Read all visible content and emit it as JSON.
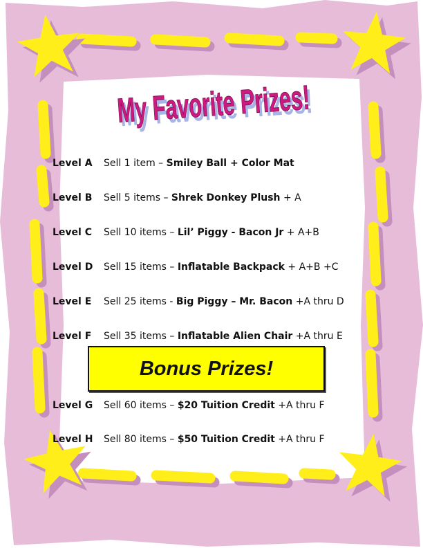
{
  "title": "My Favorite Prizes!",
  "colors": {
    "frame": "#e6bcd9",
    "frame_shadow": "#c48fbd",
    "star": "#ffee1a",
    "title": "#cc1a80",
    "bonus_bg": "#ffff00"
  },
  "levels": [
    {
      "level": "Level A",
      "pre": "Sell 1 item – ",
      "prize": "Smiley Ball + Color Mat",
      "post": ""
    },
    {
      "level": "Level B",
      "pre": "Sell 5 items – ",
      "prize": "Shrek Donkey Plush",
      "post": " + A"
    },
    {
      "level": "Level C",
      "pre": "Sell 10 items – ",
      "prize": "Lil’ Piggy - Bacon Jr",
      "post": " + A+B"
    },
    {
      "level": "Level D",
      "pre": "Sell 15 items – ",
      "prize": "Inflatable Backpack",
      "post": " + A+B +C"
    },
    {
      "level": "Level E",
      "pre": "Sell 25 items - ",
      "prize": "Big Piggy – Mr. Bacon",
      "post": " +A thru D"
    },
    {
      "level": "Level F",
      "pre": "Sell 35 items – ",
      "prize": "Inflatable Alien Chair",
      "post": " +A thru E"
    },
    {
      "level": "Level G",
      "pre": "Sell 60 items – ",
      "prize": "$20 Tuition Credit",
      "post": " +A thru F"
    },
    {
      "level": "Level H",
      "pre": "Sell 80 items – ",
      "prize": "$50 Tuition Credit",
      "post": " +A thru F"
    }
  ],
  "bonus": {
    "label": "Bonus Prizes!"
  }
}
